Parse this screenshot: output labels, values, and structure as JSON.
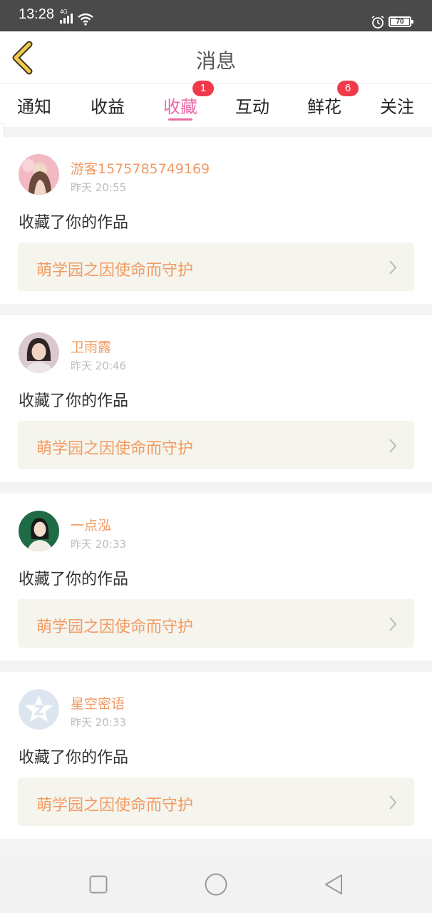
{
  "status_bar": {
    "time": "13:28",
    "network": "4G",
    "battery": "70"
  },
  "header": {
    "title": "消息"
  },
  "tabs": [
    {
      "label": "通知",
      "active": false,
      "badge": null
    },
    {
      "label": "收益",
      "active": false,
      "badge": null
    },
    {
      "label": "收藏",
      "active": true,
      "badge": "1"
    },
    {
      "label": "互动",
      "active": false,
      "badge": null
    },
    {
      "label": "鲜花",
      "active": false,
      "badge": "6"
    },
    {
      "label": "关注",
      "active": false,
      "badge": null
    }
  ],
  "messages": [
    {
      "user": "游客1575785749169",
      "time": "昨天 20:55",
      "action": "收藏了你的作品",
      "work": "萌学园之因使命而守护",
      "avatar": "avatar-photo"
    },
    {
      "user": "卫雨露",
      "time": "昨天 20:46",
      "action": "收藏了你的作品",
      "work": "萌学园之因使命而守护",
      "avatar": "avatar-photo"
    },
    {
      "user": "一点泓",
      "time": "昨天 20:33",
      "action": "收藏了你的作品",
      "work": "萌学园之因使命而守护",
      "avatar": "avatar-photo"
    },
    {
      "user": "星空密语",
      "time": "昨天 20:33",
      "action": "收藏了你的作品",
      "work": "萌学园之因使命而守护",
      "avatar": "default-star-avatar"
    }
  ],
  "colors": {
    "accent_pink": "#ea6aa6",
    "username_orange": "#f09a63",
    "badge_red": "#f03a4a",
    "back_arrow": "#f2c94c"
  }
}
